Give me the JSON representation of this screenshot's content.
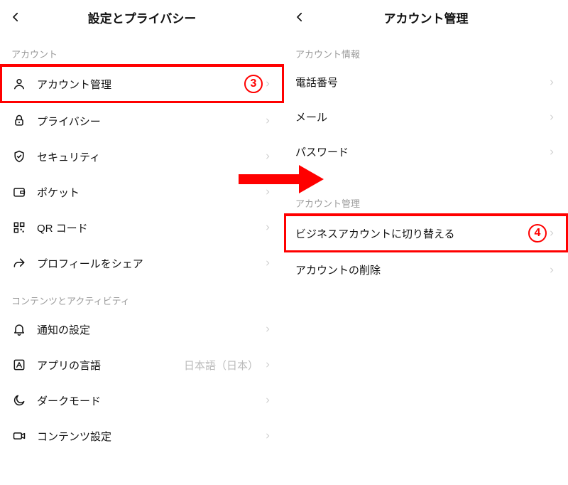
{
  "leftPane": {
    "title": "設定とプライバシー",
    "sections": [
      {
        "header": "アカウント",
        "items": [
          {
            "id": "account-manage",
            "label": "アカウント管理",
            "icon": "person",
            "highlight": true,
            "callout": "3"
          },
          {
            "id": "privacy",
            "label": "プライバシー",
            "icon": "lock"
          },
          {
            "id": "security",
            "label": "セキュリティ",
            "icon": "shield"
          },
          {
            "id": "pocket",
            "label": "ポケット",
            "icon": "wallet"
          },
          {
            "id": "qr",
            "label": "QR コード",
            "icon": "qr"
          },
          {
            "id": "share",
            "label": "プロフィールをシェア",
            "icon": "share"
          }
        ]
      },
      {
        "header": "コンテンツとアクティビティ",
        "items": [
          {
            "id": "notifications",
            "label": "通知の設定",
            "icon": "bell"
          },
          {
            "id": "language",
            "label": "アプリの言語",
            "icon": "language",
            "value": "日本語（日本）"
          },
          {
            "id": "dark",
            "label": "ダークモード",
            "icon": "moon"
          },
          {
            "id": "content",
            "label": "コンテンツ設定",
            "icon": "video"
          }
        ]
      }
    ]
  },
  "rightPane": {
    "title": "アカウント管理",
    "sections": [
      {
        "header": "アカウント情報",
        "items": [
          {
            "id": "phone",
            "label": "電話番号"
          },
          {
            "id": "email",
            "label": "メール"
          },
          {
            "id": "password",
            "label": "パスワード"
          }
        ]
      },
      {
        "header": "アカウント管理",
        "items": [
          {
            "id": "business",
            "label": "ビジネスアカウントに切り替える",
            "highlight": true,
            "callout": "4"
          },
          {
            "id": "delete",
            "label": "アカウントの削除"
          }
        ]
      }
    ]
  }
}
